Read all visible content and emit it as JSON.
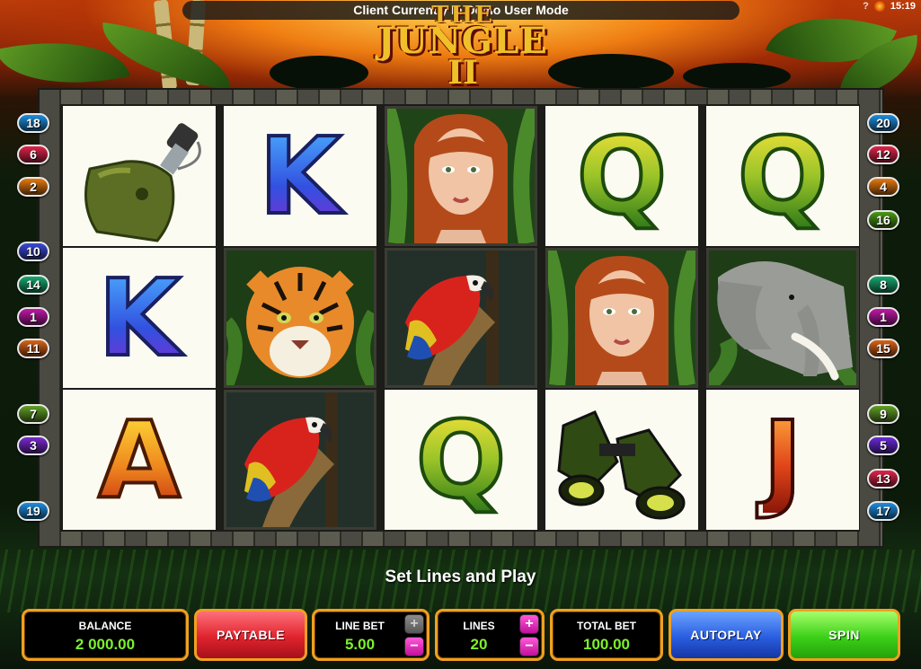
{
  "top_bar": {
    "message": "Client Currently In Demo User Mode"
  },
  "status_bar": {
    "help": "?",
    "time": "15:19"
  },
  "logo": {
    "line1": "THE",
    "line2": "JUNGLE",
    "line3": "II"
  },
  "reels": [
    [
      "canteen",
      "K",
      "A"
    ],
    [
      "K",
      "tiger",
      "parrot"
    ],
    [
      "woman",
      "parrot",
      "Q"
    ],
    [
      "Q",
      "woman",
      "binoculars"
    ],
    [
      "Q",
      "elephant",
      "J"
    ]
  ],
  "lines_left": [
    {
      "n": "18",
      "color": "#1e8fe0"
    },
    {
      "n": "6",
      "color": "#e0254a"
    },
    {
      "n": "2",
      "color": "#e87a10"
    },
    {
      "n": "10",
      "color": "#3a4ad8"
    },
    {
      "n": "14",
      "color": "#18a870"
    },
    {
      "n": "1",
      "color": "#c01aa8"
    },
    {
      "n": "11",
      "color": "#d8641a"
    },
    {
      "n": "7",
      "color": "#62a028"
    },
    {
      "n": "3",
      "color": "#7a2ad0"
    },
    {
      "n": "19",
      "color": "#1e8fe0"
    }
  ],
  "lines_right": [
    {
      "n": "20",
      "color": "#1e8fe0"
    },
    {
      "n": "12",
      "color": "#e0254a"
    },
    {
      "n": "4",
      "color": "#e87a10"
    },
    {
      "n": "16",
      "color": "#4c9a18"
    },
    {
      "n": "8",
      "color": "#18a870"
    },
    {
      "n": "1",
      "color": "#c01aa8"
    },
    {
      "n": "15",
      "color": "#d8641a"
    },
    {
      "n": "9",
      "color": "#62a028"
    },
    {
      "n": "5",
      "color": "#6a2ad8"
    },
    {
      "n": "13",
      "color": "#e0254a"
    },
    {
      "n": "17",
      "color": "#1e8fe0"
    }
  ],
  "message": "Set Lines and Play",
  "controls": {
    "balance_label": "BALANCE",
    "balance_value": "2 000.00",
    "paytable_label": "PAYTABLE",
    "line_bet_label": "LINE BET",
    "line_bet_value": "5.00",
    "lines_label": "LINES",
    "lines_value": "20",
    "total_bet_label": "TOTAL BET",
    "total_bet_value": "100.00",
    "autoplay_label": "AUTOPLAY",
    "spin_label": "SPIN",
    "plus": "+",
    "minus": "−"
  }
}
